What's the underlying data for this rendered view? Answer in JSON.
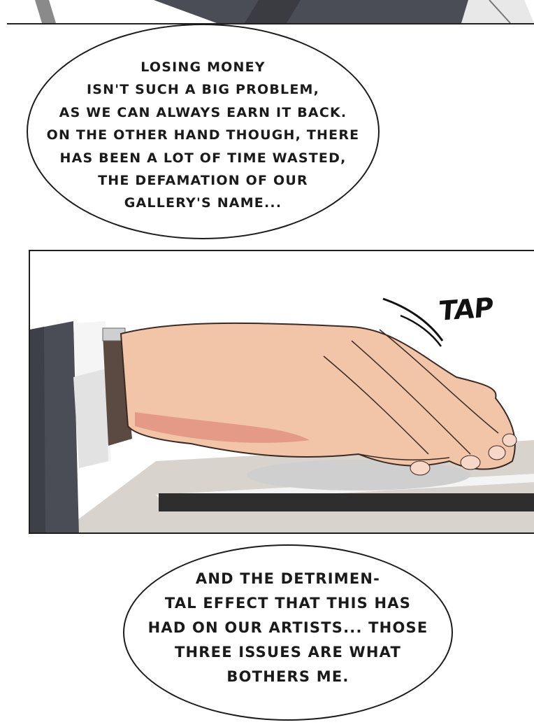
{
  "top_panel": {
    "description_icon": "suit-fragment"
  },
  "bubble_1": {
    "lines": [
      "LOSING MONEY",
      "ISN'T SUCH A BIG PROBLEM,",
      "AS WE CAN ALWAYS EARN IT BACK.",
      "ON THE OTHER HAND THOUGH, THERE",
      "HAS BEEN A LOT OF TIME WASTED,",
      "THE DEFAMATION OF OUR",
      "GALLERY'S NAME..."
    ]
  },
  "sfx": {
    "text": "TAP"
  },
  "bubble_2": {
    "lines": [
      "AND THE DETRIMEN-",
      "TAL EFFECT THAT THIS HAS",
      "HAD ON OUR ARTISTS... THOSE",
      "THREE ISSUES ARE WHAT",
      "BOTHERS ME."
    ]
  },
  "colors": {
    "skin": "#f2c4a8",
    "skin_shadow": "#e49a86",
    "suit": "#4a4d55",
    "strap": "#5a4a42",
    "desk": "#d8d3cc"
  }
}
